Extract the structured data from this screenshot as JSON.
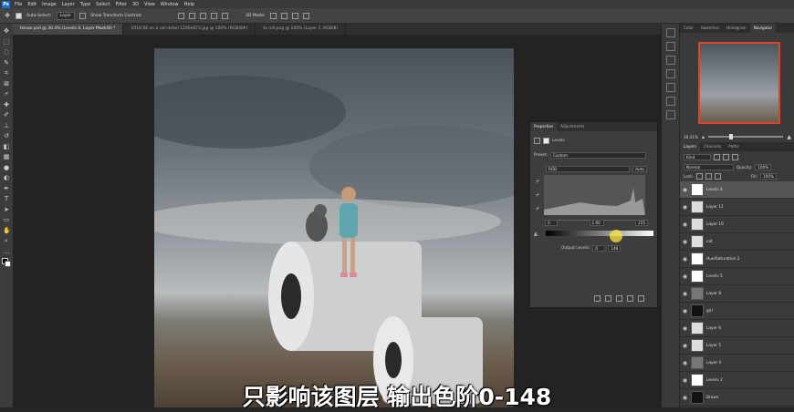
{
  "menubar": {
    "logo": "Ps",
    "items": [
      "File",
      "Edit",
      "Image",
      "Layer",
      "Type",
      "Select",
      "Filter",
      "3D",
      "View",
      "Window",
      "Help"
    ]
  },
  "options_bar": {
    "auto_select": "Auto-Select:",
    "auto_select_value": "Layer",
    "transform": "Show Transform Controls",
    "mode_3d": "3D Mode:"
  },
  "tabs": [
    {
      "label": "tissue.psd @ 30.4% (Levels 4, Layer Mask/8) *",
      "active": true
    },
    {
      "label": "2018 08 on a roll detail 1200x673.jpg @ 100% (RGB/8#)",
      "active": false
    },
    {
      "label": "tx roll.png @ 100% (Layer 1, RGB/8)",
      "active": false
    }
  ],
  "properties": {
    "tabs": [
      "Properties",
      "Adjustments"
    ],
    "type": "Levels",
    "preset_label": "Preset:",
    "preset_value": "Custom",
    "channel": "RGB",
    "auto_button": "Auto",
    "input_black": "0",
    "input_gamma": "1.00",
    "input_white": "255",
    "output_label": "Output Levels:",
    "output_black": "0",
    "output_white": "148"
  },
  "navigator": {
    "tabs": [
      "Color",
      "Swatches",
      "Histogram",
      "Navigator"
    ],
    "zoom": "30.41%"
  },
  "layers": {
    "tabs": [
      "Layers",
      "Channels",
      "Paths"
    ],
    "filter": "Kind",
    "blend_mode": "Normal",
    "opacity_label": "Opacity:",
    "opacity": "100%",
    "lock_label": "Lock:",
    "fill_label": "Fill:",
    "fill": "100%",
    "items": [
      {
        "name": "Levels 4",
        "thumb": "white"
      },
      {
        "name": "Layer 11",
        "thumb": "light"
      },
      {
        "name": "Layer 10",
        "thumb": "light"
      },
      {
        "name": "cat",
        "thumb": "light"
      },
      {
        "name": "Hue/Saturation 2",
        "thumb": "white"
      },
      {
        "name": "Levels 5",
        "thumb": "white"
      },
      {
        "name": "Layer 8",
        "thumb": "dark"
      },
      {
        "name": "girl",
        "thumb": "black"
      },
      {
        "name": "Layer 6",
        "thumb": "light"
      },
      {
        "name": "Layer 5",
        "thumb": "light"
      },
      {
        "name": "Layer 4",
        "thumb": "dark"
      },
      {
        "name": "Levels 2",
        "thumb": "white"
      },
      {
        "name": "Brown",
        "thumb": "black"
      }
    ]
  },
  "subtitle": "只影响该图层 输出色阶0-148"
}
